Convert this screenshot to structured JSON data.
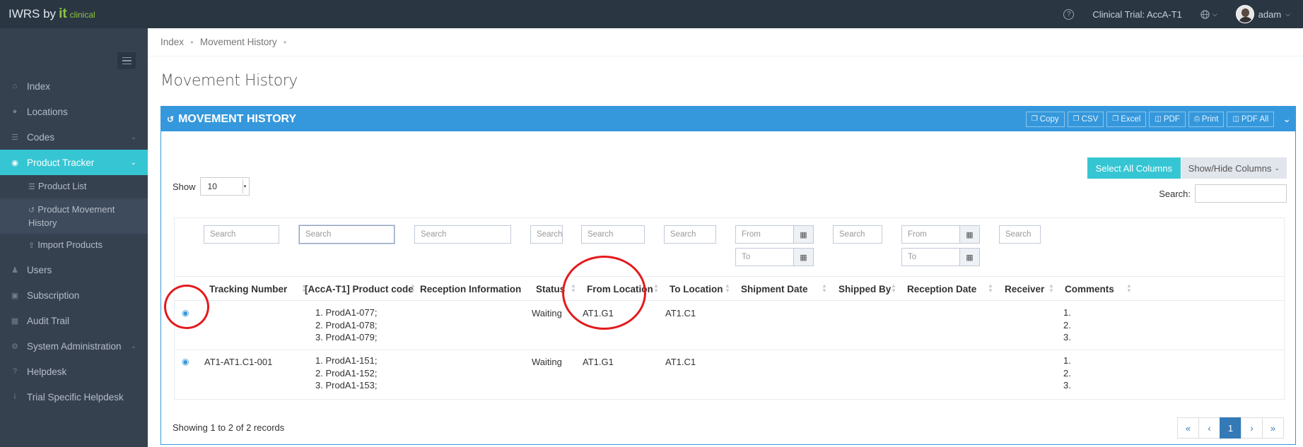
{
  "topbar": {
    "brand_prefix": "IWRS by ",
    "brand_it": "it",
    "brand_clinical": "clinical",
    "help_glyph": "?",
    "clinical_trial": "Clinical Trial: AccA-T1",
    "user_name": "adam"
  },
  "sidebar": {
    "items": [
      {
        "label": "Index",
        "icon": "home-icon"
      },
      {
        "label": "Locations",
        "icon": "globe-icon"
      },
      {
        "label": "Codes",
        "icon": "list-icon"
      },
      {
        "label": "Product Tracker",
        "icon": "map-pin-icon"
      },
      {
        "label": "Users",
        "icon": "users-icon"
      },
      {
        "label": "Subscription",
        "icon": "newspaper-icon"
      },
      {
        "label": "Audit Trail",
        "icon": "book-icon"
      },
      {
        "label": "System Administration",
        "icon": "gears-icon"
      },
      {
        "label": "Helpdesk",
        "icon": "question-icon"
      },
      {
        "label": "Trial Specific Helpdesk",
        "icon": "info-icon"
      }
    ],
    "subitems": [
      {
        "label": "Product List"
      },
      {
        "label": "Product Movement History"
      },
      {
        "label": "Import Products"
      }
    ]
  },
  "breadcrumb": [
    "Index",
    "Movement History"
  ],
  "page_title": "Movement History",
  "portlet": {
    "title": "MOVEMENT HISTORY",
    "tools": [
      "Copy",
      "CSV",
      "Excel",
      "PDF",
      "Print",
      "PDF All"
    ]
  },
  "controls": {
    "select_all": "Select All Columns",
    "show_hide": "Show/Hide Columns",
    "show_label": "Show",
    "page_length": "10",
    "search_label": "Search:"
  },
  "filters": {
    "search_placeholder": "Search",
    "from_placeholder": "From",
    "to_placeholder": "To"
  },
  "table": {
    "columns": [
      "Tracking Number",
      "[AccA-T1] Product code",
      "Reception Information",
      "Status",
      "From Location",
      "To Location",
      "Shipment Date",
      "Shipped By",
      "Reception Date",
      "Receiver",
      "Comments"
    ],
    "rows": [
      {
        "tracking": "",
        "products": [
          "1. ProdA1-077;",
          "2. ProdA1-078;",
          "3. ProdA1-079;"
        ],
        "status": "Waiting",
        "from": "AT1.G1",
        "to": "AT1.C1",
        "comments": [
          "1.",
          "2.",
          "3."
        ]
      },
      {
        "tracking": "AT1-AT1.C1-001",
        "products": [
          "1. ProdA1-151;",
          "2. ProdA1-152;",
          "3. ProdA1-153;"
        ],
        "status": "Waiting",
        "from": "AT1.G1",
        "to": "AT1.C1",
        "comments": [
          "1.",
          "2.",
          "3."
        ]
      }
    ]
  },
  "footer": {
    "info": "Showing 1 to 2 of 2 records",
    "pages": [
      "«",
      "‹",
      "1",
      "›",
      "»"
    ],
    "current_page": "1"
  },
  "colors": {
    "sidebar_bg": "#364150",
    "topbar_bg": "#2b3643",
    "active_item": "#36c6d3",
    "portlet_head": "#3598dc",
    "annotation": "#e41a1c"
  }
}
